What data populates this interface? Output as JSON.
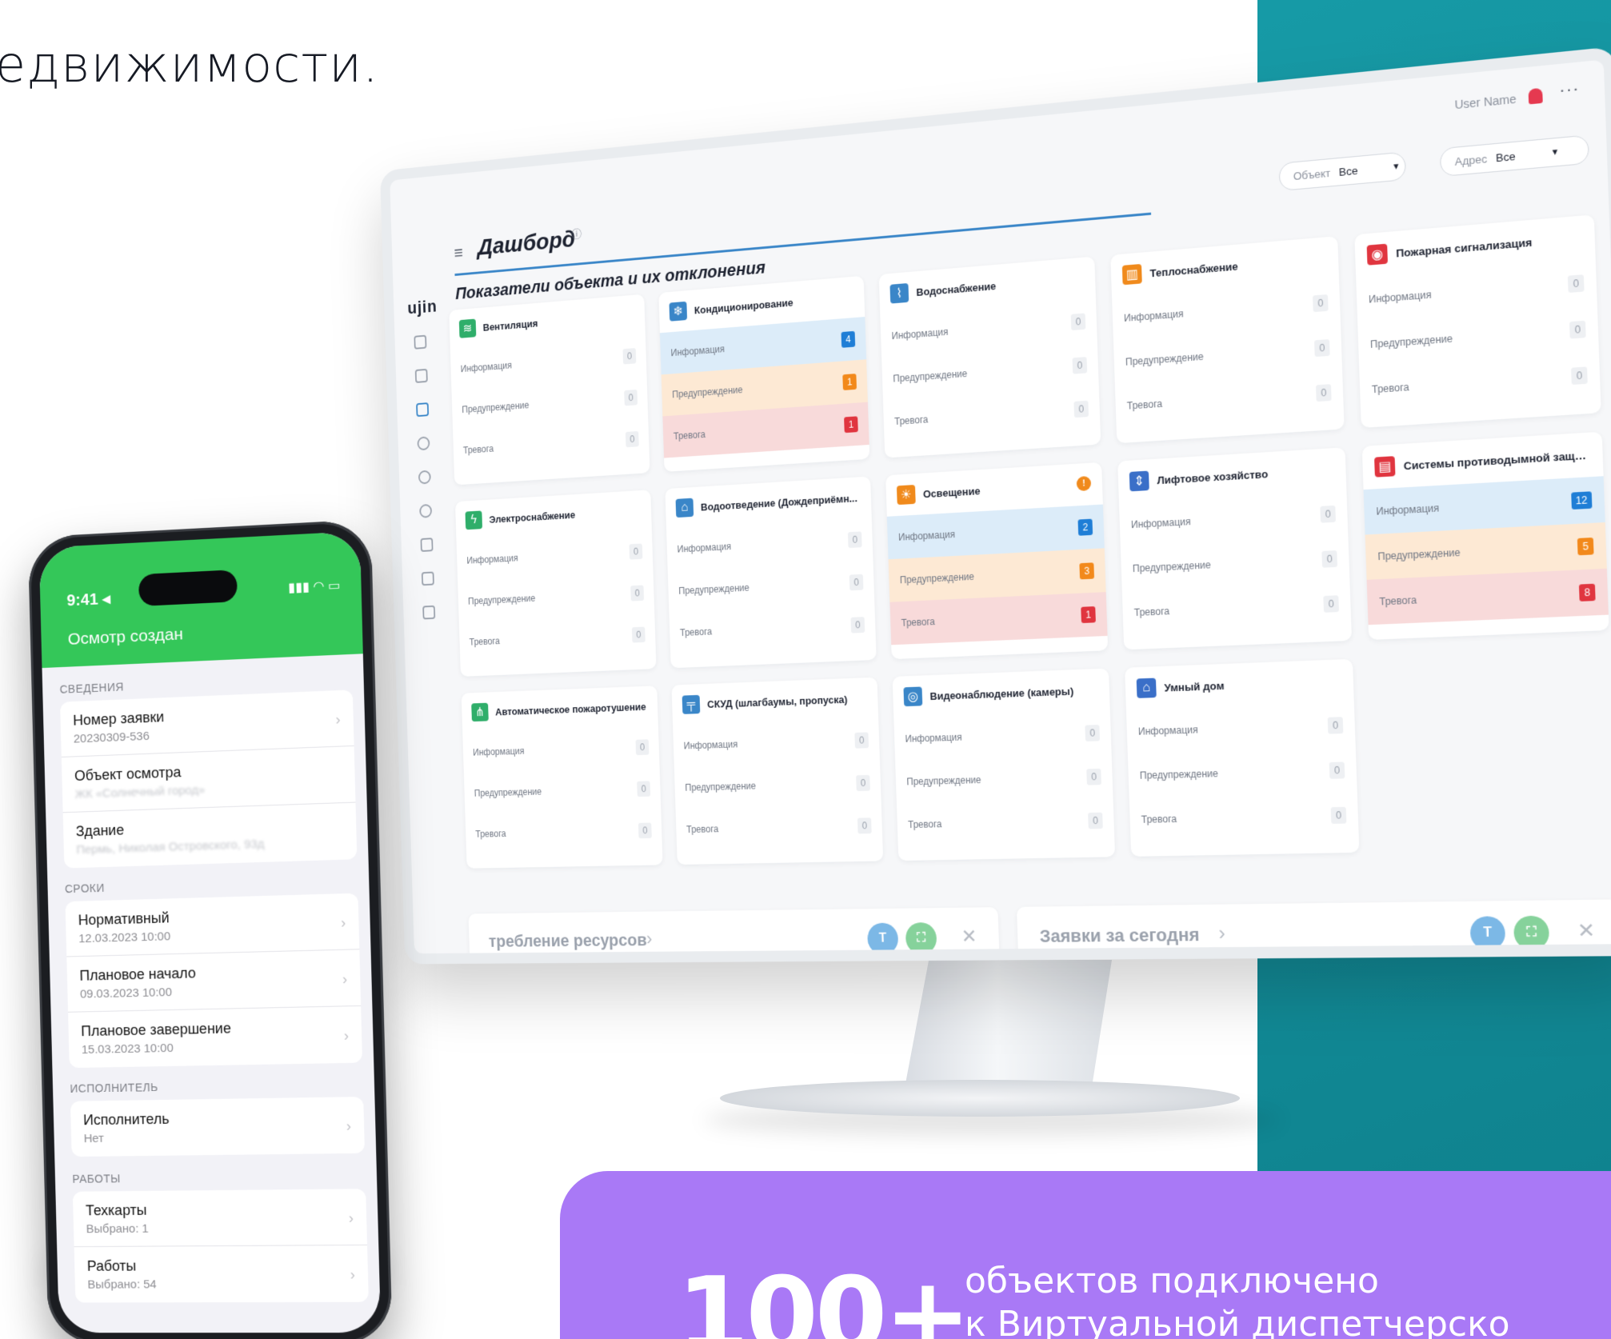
{
  "headline": "едвижимости.",
  "dashboard": {
    "user_name": "User Name",
    "more": "···",
    "logo": "ujin",
    "title": "Дашборд",
    "info_mark": "ⓘ",
    "filters": [
      {
        "label": "Объект",
        "value": "Все"
      },
      {
        "label": "Адрес",
        "value": "Все"
      }
    ],
    "section_title": "Показатели объекта и их отклонения",
    "row_labels": {
      "info": "Информация",
      "warn": "Предупреждение",
      "alarm": "Тревога"
    },
    "cards": [
      {
        "title": "Вентиляция",
        "icon": "ventilation-icon",
        "glyph": "≋",
        "color": "#2fae6a",
        "info": "0",
        "warn": "0",
        "alarm": "0",
        "active": false
      },
      {
        "title": "Кондиционирование",
        "icon": "snowflake-icon",
        "glyph": "❄",
        "color": "#3a86c8",
        "info": "4",
        "warn": "1",
        "alarm": "1",
        "active": true
      },
      {
        "title": "Водоснабжение",
        "icon": "water-tap-icon",
        "glyph": "⌇",
        "color": "#3a86c8",
        "info": "0",
        "warn": "0",
        "alarm": "0",
        "active": false
      },
      {
        "title": "Теплоснабжение",
        "icon": "radiator-icon",
        "glyph": "▥",
        "color": "#f08a1c",
        "info": "0",
        "warn": "0",
        "alarm": "0",
        "active": false
      },
      {
        "title": "Пожарная сигнализация",
        "icon": "fire-alarm-icon",
        "glyph": "◉",
        "color": "#e0353f",
        "info": "0",
        "warn": "0",
        "alarm": "0",
        "active": false
      },
      {
        "title": "Электроснабжение",
        "icon": "electricity-icon",
        "glyph": "ϟ",
        "color": "#2fae6a",
        "info": "0",
        "warn": "0",
        "alarm": "0",
        "active": false
      },
      {
        "title": "Водоотведение (Дождеприёмн...",
        "icon": "drainage-icon",
        "glyph": "⌂",
        "color": "#3a86c8",
        "info": "0",
        "warn": "0",
        "alarm": "0",
        "active": false
      },
      {
        "title": "Освещение",
        "icon": "light-bulb-icon",
        "glyph": "☀",
        "color": "#f08a1c",
        "info": "2",
        "warn": "3",
        "alarm": "1",
        "active": true,
        "badge": "!"
      },
      {
        "title": "Лифтовое хозяйство",
        "icon": "elevator-icon",
        "glyph": "⇕",
        "color": "#3a6fc8",
        "info": "0",
        "warn": "0",
        "alarm": "0",
        "active": false
      },
      {
        "title": "Системы противодымной защи...",
        "icon": "smoke-protection-icon",
        "glyph": "▤",
        "color": "#e0353f",
        "info": "12",
        "warn": "5",
        "alarm": "8",
        "active": true
      },
      {
        "title": "Автоматическое пожаротушение",
        "icon": "sprinkler-icon",
        "glyph": "⋔",
        "color": "#2fae6a",
        "info": "0",
        "warn": "0",
        "alarm": "0",
        "active": false
      },
      {
        "title": "СКУД (шлагбаумы, пропуска)",
        "icon": "barrier-icon",
        "glyph": "╤",
        "color": "#3a86c8",
        "info": "0",
        "warn": "0",
        "alarm": "0",
        "active": false
      },
      {
        "title": "Видеонаблюдение (камеры)",
        "icon": "camera-icon",
        "glyph": "◎",
        "color": "#3a86c8",
        "info": "0",
        "warn": "0",
        "alarm": "0",
        "active": false
      },
      {
        "title": "Умный дом",
        "icon": "smart-home-icon",
        "glyph": "⌂",
        "color": "#3a6fc8",
        "info": "0",
        "warn": "0",
        "alarm": "0",
        "active": false
      }
    ],
    "bottom": [
      {
        "title": "требление ресурсов"
      },
      {
        "title": "Заявки за сегодня"
      }
    ]
  },
  "phone": {
    "time": "9:41 ◂",
    "status_icons": "▮▮▮ ◠ ▭",
    "title": "Осмотр создан",
    "sections": {
      "info": "СВЕДЕНИЯ",
      "deadlines": "СРОКИ",
      "executor": "ИСПОЛНИТЕЛЬ",
      "works": "РАБОТЫ"
    },
    "info_items": [
      {
        "label": "Номер заявки",
        "value": "20230309-536"
      },
      {
        "label": "Объект осмотра",
        "value": "ЖК «Солнечный город»"
      },
      {
        "label": "Здание",
        "value": "Пермь, Николая Островского, 93д"
      }
    ],
    "deadline_items": [
      {
        "label": "Нормативный",
        "value": "12.03.2023 10:00"
      },
      {
        "label": "Плановое начало",
        "value": "09.03.2023 10:00"
      },
      {
        "label": "Плановое завершение",
        "value": "15.03.2023 10:00"
      }
    ],
    "executor_items": [
      {
        "label": "Исполнитель",
        "value": "Нет"
      }
    ],
    "work_items": [
      {
        "label": "Техкарты",
        "value": "Выбрано: 1"
      },
      {
        "label": "Работы",
        "value": "Выбрано: 54"
      }
    ]
  },
  "banner": {
    "number": "100+",
    "line1": "объектов подключено",
    "line2": "к Виртуальной диспетчерско"
  },
  "colors": {
    "teal": "#169aa6",
    "purple": "#a979f6",
    "green_header": "#34c759",
    "info_blue": "#1f7ed6",
    "warn_orange": "#f2891b",
    "alarm_red": "#e0353f"
  }
}
